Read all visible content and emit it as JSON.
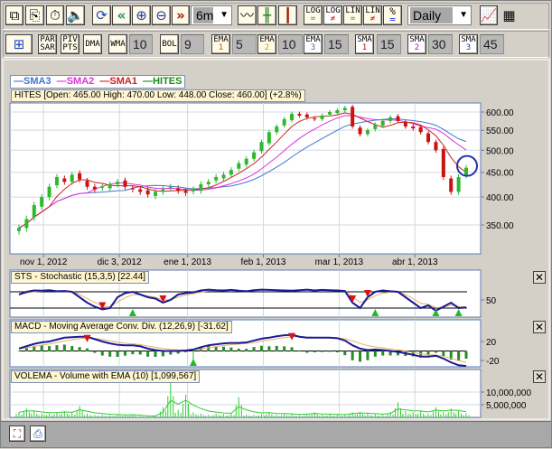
{
  "toolbar1": {
    "period": "6m",
    "interval": "Daily",
    "log_eq": "LOG",
    "log_ne": "LOG",
    "lin_eq": "LIN",
    "lin_ne": "LIN",
    "pct": "%",
    "eq": "=",
    "ne": "≠"
  },
  "toolbar2": {
    "par": "PAR",
    "sar": "SAR",
    "piv": "PIV",
    "pts": "PTS",
    "dma": "DMA",
    "wma": "WMA",
    "wma_val": "10",
    "bol": "BOL",
    "bol_val": "9",
    "ema": "EMA",
    "ema1": "1",
    "ema1_val": "5",
    "ema2": "2",
    "ema2_val": "10",
    "ema3": "3",
    "ema3_val": "15",
    "sma": "SMA",
    "sma1": "1",
    "sma1_val": "15",
    "sma2": "2",
    "sma2_val": "30",
    "sma3": "3",
    "sma3_val": "45"
  },
  "colors": {
    "up": "#2eb82e",
    "down": "#cc1111",
    "sma1": "#cc2222",
    "sma2": "#dd33dd",
    "sma3": "#4477cc",
    "macd": "#1a1a9a",
    "signal": "#e8b060",
    "hist": "#2a8a2a",
    "vol": "#33cc33",
    "marker_up": "#22bb22",
    "marker_down": "#dd1111"
  },
  "chart_data": [
    {
      "type": "candlestick",
      "title": "HITES [Open: 465.00  High: 470.00  Low: 448.00  Close: 460.00] (+2.8%)",
      "legend": [
        {
          "name": "SMA3",
          "color": "#4477cc"
        },
        {
          "name": "SMA2",
          "color": "#dd33dd"
        },
        {
          "name": "SMA1",
          "color": "#cc2222"
        },
        {
          "name": "HITES",
          "color": "#1a8a1a"
        }
      ],
      "y_ticks": [
        "600.00",
        "550.00",
        "500.00",
        "450.00",
        "400.00",
        "350.00"
      ],
      "y_values": [
        600,
        550,
        500,
        450,
        400,
        350
      ],
      "ylim": [
        315,
        625
      ],
      "scale": "log",
      "x_ticks": [
        "nov 1, 2012",
        "dic 3, 2012",
        "ene 1, 2013",
        "feb 1, 2013",
        "mar 1, 2013",
        "abr 1, 2013"
      ],
      "x_tick_index": [
        3,
        13,
        22,
        32,
        42,
        52
      ],
      "close": [
        345,
        360,
        385,
        400,
        420,
        440,
        430,
        445,
        435,
        420,
        415,
        420,
        425,
        430,
        420,
        415,
        410,
        405,
        410,
        415,
        420,
        412,
        408,
        415,
        425,
        430,
        440,
        445,
        455,
        470,
        480,
        495,
        520,
        545,
        560,
        580,
        595,
        590,
        585,
        580,
        590,
        600,
        605,
        612,
        560,
        540,
        550,
        565,
        575,
        585,
        575,
        560,
        555,
        545,
        520,
        500,
        440,
        410,
        440,
        460
      ]
    },
    {
      "type": "line",
      "title": "STS - Stochastic (15,3,5) [22.44]",
      "y_ticks": [
        "50"
      ],
      "levels": [
        80,
        20
      ],
      "k": [
        70,
        80,
        85,
        84,
        86,
        82,
        83,
        80,
        60,
        40,
        25,
        15,
        20,
        60,
        75,
        80,
        70,
        60,
        55,
        40,
        50,
        70,
        75,
        78,
        85,
        88,
        86,
        85,
        87,
        84,
        82,
        86,
        88,
        87,
        86,
        85,
        84,
        86,
        88,
        85,
        87,
        86,
        85,
        83,
        40,
        20,
        60,
        80,
        85,
        82,
        80,
        60,
        40,
        20,
        30,
        10,
        25,
        40,
        20,
        22.44
      ],
      "sell_signals": [
        11,
        19,
        44,
        46
      ],
      "buy_signals": [
        15,
        47,
        55,
        58
      ]
    },
    {
      "type": "line",
      "title": "MACD - Moving Average Conv. Div. (12,26,9) [-31.62]",
      "y_ticks": [
        "20",
        "-20"
      ],
      "macd": [
        5,
        10,
        15,
        18,
        20,
        24,
        28,
        29,
        30,
        30,
        25,
        20,
        16,
        13,
        12,
        12,
        10,
        5,
        2,
        0,
        0,
        0,
        1,
        3,
        8,
        12,
        14,
        16,
        17,
        17,
        18,
        22,
        26,
        28,
        31,
        33,
        34,
        30,
        28,
        28,
        28,
        28,
        27,
        22,
        12,
        5,
        2,
        3,
        2,
        0,
        -2,
        -5,
        -8,
        -12,
        -12,
        -10,
        -16,
        -24,
        -30,
        -31.62
      ],
      "sell_signals": [
        9,
        36
      ],
      "buy_signals": [
        23
      ]
    },
    {
      "type": "bar",
      "title": "VOLEMA - Volume with EMA (10) [1,099,567]",
      "y_ticks": [
        "10,000,000",
        "5,000,000"
      ],
      "volume_m": [
        2,
        3.5,
        2.5,
        1.5,
        1.5,
        2,
        2.5,
        1.8,
        4.5,
        1.5,
        1,
        1,
        0.8,
        1,
        0.8,
        1.2,
        0.5,
        0.3,
        0.5,
        4,
        14,
        3,
        9,
        2,
        1.5,
        1,
        1.5,
        1.2,
        1.5,
        8,
        1.2,
        1,
        1.2,
        2,
        1,
        1.5,
        1.2,
        0.8,
        1.5,
        2,
        1,
        1.2,
        1,
        1,
        2,
        2.2,
        1.5,
        1.2,
        1,
        2,
        6,
        2.5,
        2,
        2.5,
        1.5,
        4,
        2,
        3.5,
        2.5,
        1.5
      ]
    }
  ]
}
